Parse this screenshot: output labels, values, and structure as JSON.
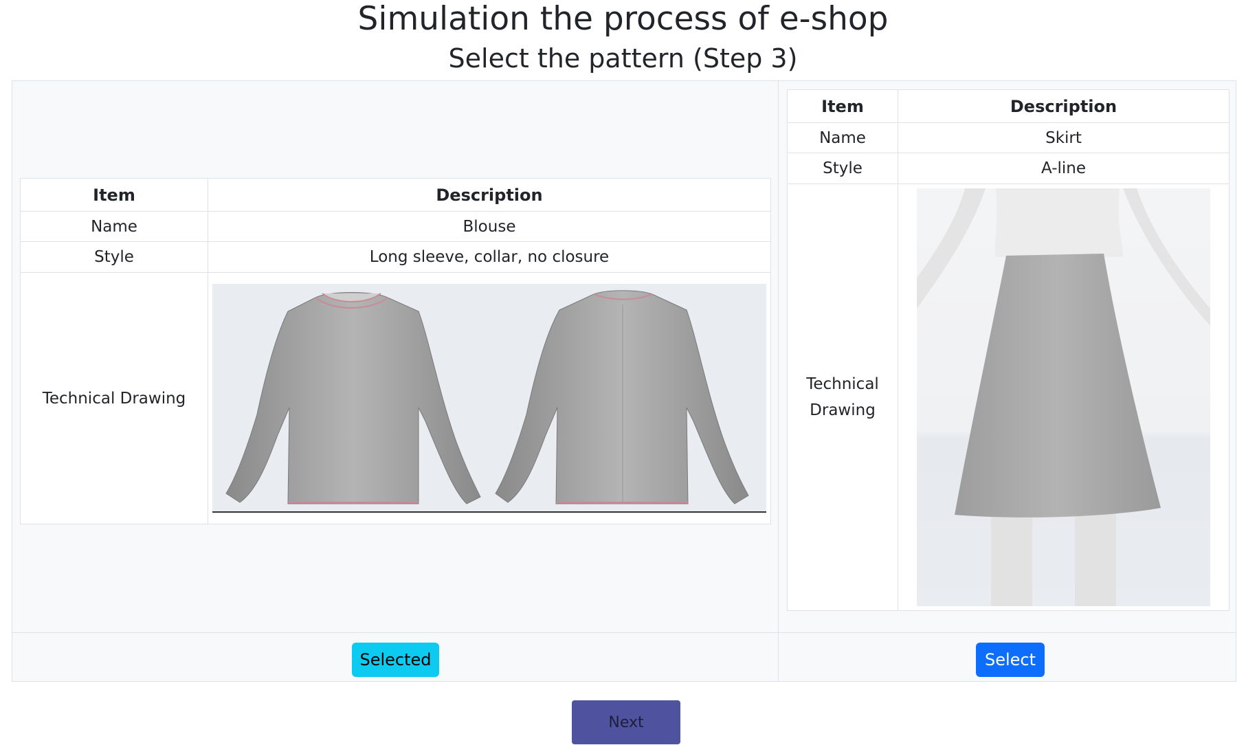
{
  "header": {
    "title": "Simulation the process of e-shop",
    "subtitle": "Select the pattern (Step 3)"
  },
  "options": [
    {
      "table_header": {
        "item": "Item",
        "description": "Description"
      },
      "rows": [
        {
          "item": "Name",
          "value": "Blouse"
        },
        {
          "item": "Style",
          "value": "Long sleeve, collar, no closure"
        }
      ],
      "drawing_label": "Technical Drawing",
      "drawing_icon": "blouse-front-back-image",
      "button_label": "Selected",
      "button_color": "#0dcaf0"
    },
    {
      "table_header": {
        "item": "Item",
        "description": "Description"
      },
      "rows": [
        {
          "item": "Name",
          "value": "Skirt"
        },
        {
          "item": "Style",
          "value": "A-line"
        }
      ],
      "drawing_label": "Technical Drawing",
      "drawing_icon": "skirt-on-mannequin-image",
      "button_label": "Select",
      "button_color": "#0d6efd"
    }
  ],
  "footer": {
    "next_label": "Next",
    "next_color": "#4f529e"
  }
}
